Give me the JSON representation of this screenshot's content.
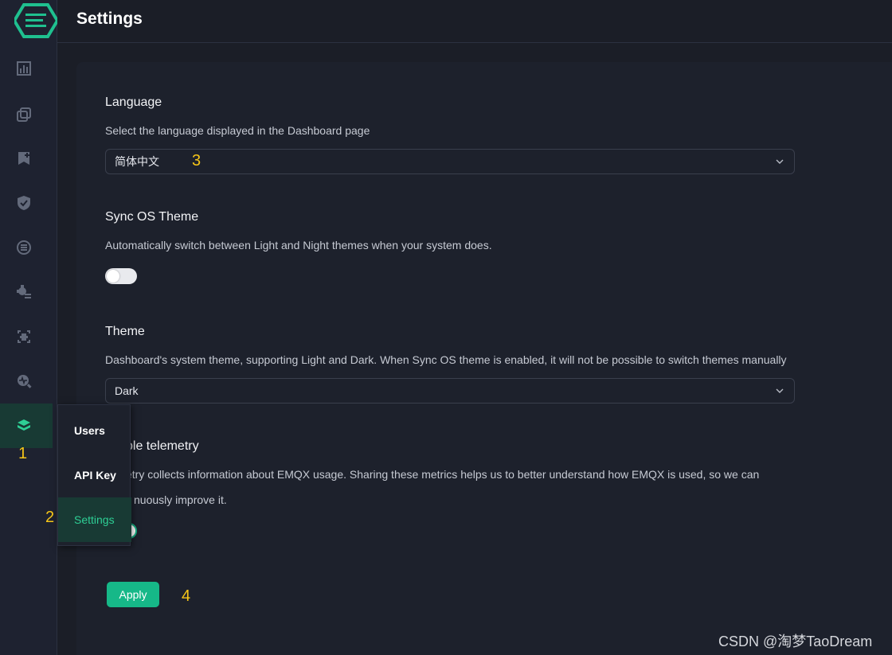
{
  "header": {
    "title": "Settings"
  },
  "sidebar": {
    "icons": [
      "monitoring-icon",
      "connections-icon",
      "bookmark-add-icon",
      "shield-icon",
      "data-integration-icon",
      "gear-plugin-icon",
      "extensions-icon",
      "diagnose-icon",
      "system-layers-icon"
    ],
    "active_icon": "system-layers-icon",
    "accent_color": "#2ecf95"
  },
  "submenu": {
    "items": [
      {
        "label": "Users"
      },
      {
        "label": "API Key"
      },
      {
        "label": "Settings",
        "active": true
      }
    ]
  },
  "settings": {
    "language": {
      "title": "Language",
      "description": "Select the language displayed in the Dashboard page",
      "value": "简体中文"
    },
    "sync_os_theme": {
      "title": "Sync OS Theme",
      "description": "Automatically switch between Light and Night themes when your system does.",
      "enabled": false
    },
    "theme": {
      "title": "Theme",
      "description": "Dashboard's system theme, supporting Light and Dark. When Sync OS theme is enabled, it will not be possible to switch themes manually",
      "value": "Dark"
    },
    "telemetry": {
      "title_visible": "ble telemetry",
      "description_line1_visible": "etry collects information about EMQX usage. Sharing these metrics helps us to better understand how EMQX is used, so we can",
      "description_line2_visible": "nuously improve it.",
      "enabled": true
    },
    "apply_label": "Apply"
  },
  "annotations": [
    "1",
    "2",
    "3",
    "4"
  ],
  "watermark": "CSDN @淘梦TaoDream",
  "colors": {
    "primary_button": "#16b888",
    "annotation": "#f5c518"
  }
}
